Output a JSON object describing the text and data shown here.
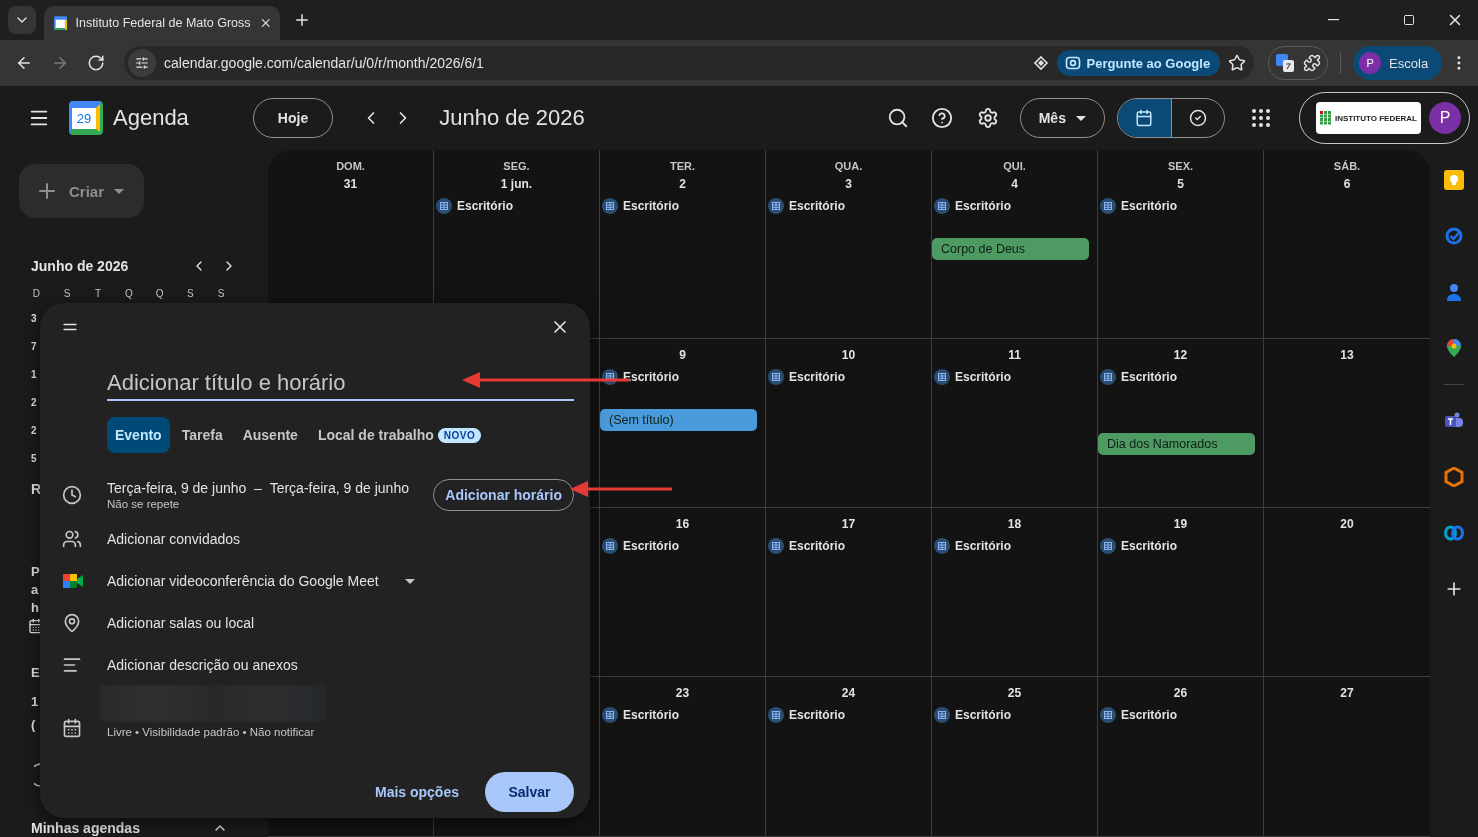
{
  "browser": {
    "tab": {
      "title": "Instituto Federal de Mato Gross"
    },
    "nav": [
      {
        "kind": "back",
        "disabled": false
      },
      {
        "kind": "forward",
        "disabled": true
      },
      {
        "kind": "reload",
        "disabled": false
      }
    ],
    "url": "calendar.google.com/calendar/u/0/r/month/2026/6/1",
    "ask_button": "Pergunte ao Google",
    "profile": {
      "initial": "P",
      "name": "Escola"
    }
  },
  "header": {
    "logo_day": "29",
    "app_name": "Agenda",
    "today_button": "Hoje",
    "period": "Junho de 2026",
    "view_menu": "Mês",
    "view_toggle": [
      {
        "kind": "calendar",
        "selected": true
      },
      {
        "kind": "tasks",
        "selected": false
      }
    ],
    "org_logo": "INSTITUTO FEDERAL",
    "avatar": "P"
  },
  "sidebar": {
    "create_button": "Criar",
    "mini_calendar": {
      "title": "Junho de 2026",
      "weekdays": [
        "D",
        "S",
        "T",
        "Q",
        "Q",
        "S",
        "S"
      ],
      "first_column": [
        "3",
        "7",
        "1",
        "2",
        "2",
        "5"
      ]
    },
    "fragments": [
      "R",
      "P",
      "a",
      "h",
      "E",
      "1",
      "("
    ],
    "section_title": "Minhas agendas"
  },
  "calendar": {
    "weeks": [
      {
        "days": [
          {
            "weekday": "DOM.",
            "day": "31"
          },
          {
            "weekday": "SEG.",
            "day": "1 jun.",
            "events": [
              {
                "kind": "working_location",
                "title": "Escritório"
              }
            ]
          },
          {
            "weekday": "TER.",
            "day": "2",
            "events": [
              {
                "kind": "working_location",
                "title": "Escritório"
              }
            ]
          },
          {
            "weekday": "QUA.",
            "day": "3",
            "events": [
              {
                "kind": "working_location",
                "title": "Escritório"
              }
            ]
          },
          {
            "weekday": "QUI.",
            "day": "4",
            "events": [
              {
                "kind": "working_location",
                "title": "Escritório"
              },
              {
                "kind": "all_day",
                "title": "Corpo de Deus",
                "color": "#4e9a63"
              }
            ]
          },
          {
            "weekday": "SEX.",
            "day": "5",
            "events": [
              {
                "kind": "working_location",
                "title": "Escritório"
              }
            ]
          },
          {
            "weekday": "SÁB.",
            "day": "6"
          }
        ]
      },
      {
        "days": [
          {
            "day": "9",
            "events": [
              {
                "kind": "working_location",
                "title": "Escritório"
              },
              {
                "kind": "all_day",
                "title": "(Sem título)",
                "color": "#4a9bdb"
              }
            ]
          },
          {
            "day": "10",
            "events": [
              {
                "kind": "working_location",
                "title": "Escritório"
              }
            ]
          },
          {
            "day": "11",
            "events": [
              {
                "kind": "working_location",
                "title": "Escritório"
              }
            ]
          },
          {
            "day": "12",
            "events": [
              {
                "kind": "working_location",
                "title": "Escritório"
              },
              {
                "kind": "all_day",
                "title": "Dia dos Namorados",
                "color": "#4e9a63"
              }
            ]
          },
          {
            "day": "13"
          }
        ]
      },
      {
        "days": [
          {
            "day": "16",
            "events": [
              {
                "kind": "working_location",
                "title": "Escritório"
              }
            ]
          },
          {
            "day": "17",
            "events": [
              {
                "kind": "working_location",
                "title": "Escritório"
              }
            ]
          },
          {
            "day": "18",
            "events": [
              {
                "kind": "working_location",
                "title": "Escritório"
              }
            ]
          },
          {
            "day": "19",
            "events": [
              {
                "kind": "working_location",
                "title": "Escritório"
              }
            ]
          },
          {
            "day": "20"
          }
        ]
      },
      {
        "days": [
          {
            "day": "23",
            "events": [
              {
                "kind": "working_location",
                "title": "Escritório"
              }
            ]
          },
          {
            "day": "24",
            "events": [
              {
                "kind": "working_location",
                "title": "Escritório"
              }
            ]
          },
          {
            "day": "25",
            "events": [
              {
                "kind": "working_location",
                "title": "Escritório"
              }
            ]
          },
          {
            "day": "26",
            "events": [
              {
                "kind": "working_location",
                "title": "Escritório"
              }
            ]
          },
          {
            "day": "27"
          }
        ]
      }
    ]
  },
  "dialog": {
    "title_placeholder": "Adicionar título e horário",
    "tabs": [
      {
        "label": "Evento",
        "selected": true
      },
      {
        "label": "Tarefa",
        "selected": false
      },
      {
        "label": "Ausente",
        "selected": false
      },
      {
        "label": "Local de trabalho",
        "selected": false,
        "badge": "NOVO"
      }
    ],
    "date": {
      "start": "Terça-feira, 9 de junho",
      "separator": "–",
      "end": "Terça-feira, 9 de junho",
      "repeat": "Não se repete",
      "time_button": "Adicionar horário"
    },
    "rows": [
      {
        "kind": "guests",
        "label": "Adicionar convidados"
      },
      {
        "kind": "meet",
        "label": "Adicionar videoconferência do Google Meet"
      },
      {
        "kind": "location",
        "label": "Adicionar salas ou local"
      },
      {
        "kind": "description",
        "label": "Adicionar descrição ou anexos"
      }
    ],
    "calendar_row": {
      "redacted": true,
      "details": "Livre • Visibilidade padrão • Não notificar"
    },
    "more_options": "Mais opções",
    "save_button": "Salvar"
  },
  "annotations": [
    {
      "kind": "arrow"
    },
    {
      "kind": "arrow"
    }
  ]
}
